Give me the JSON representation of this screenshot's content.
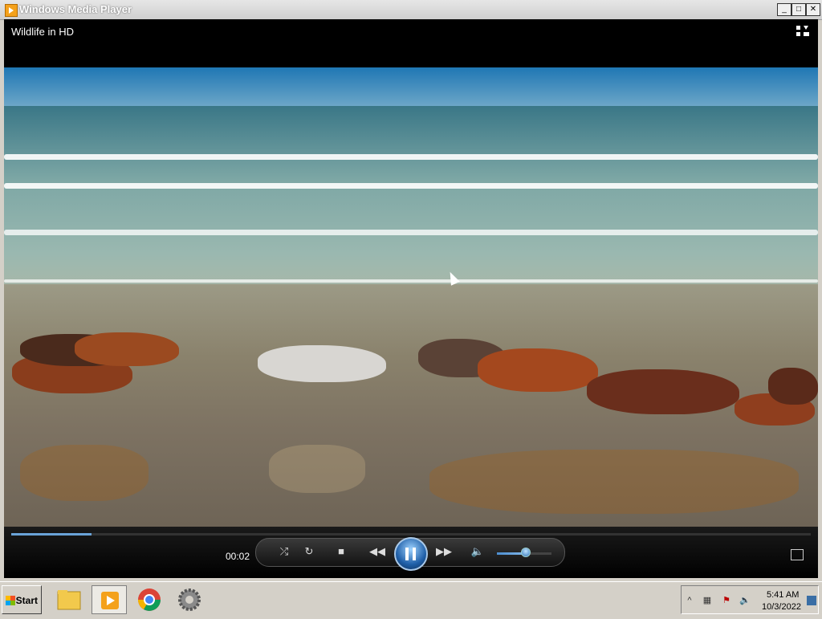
{
  "window": {
    "title": "Windows Media Player",
    "minimize": "_",
    "maximize": "□",
    "close": "✕"
  },
  "player": {
    "media_title": "Wildlife in HD",
    "elapsed": "00:02",
    "progress_fraction": 0.1,
    "volume_fraction": 0.5,
    "icons": {
      "switch_to_library": "switch-to-library-icon",
      "shuffle": "shuffle-icon",
      "repeat": "repeat-icon",
      "stop": "stop-icon",
      "previous": "previous-icon",
      "pause": "pause-icon",
      "next": "next-icon",
      "mute": "speaker-icon",
      "fullscreen": "fullscreen-icon"
    },
    "accent_color": "#6aa3d8"
  },
  "taskbar": {
    "start_label": "Start",
    "apps": [
      "file-explorer-icon",
      "windows-media-player-icon",
      "chrome-icon",
      "settings-icon"
    ],
    "tray": {
      "time": "5:41 AM",
      "date": "10/3/2022",
      "show_hidden": "^"
    }
  }
}
